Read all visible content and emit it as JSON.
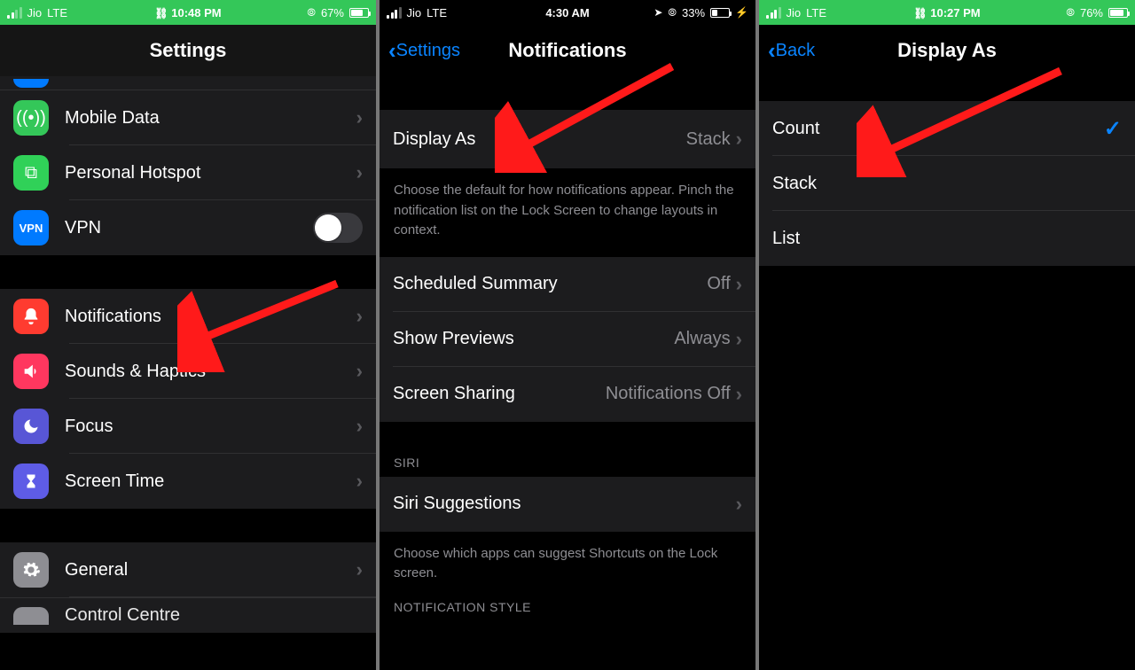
{
  "panel1": {
    "status": {
      "carrier": "Jio",
      "net": "LTE",
      "time": "10:48 PM",
      "battery_pct": "67%",
      "alarm": true,
      "hotspot_link": true
    },
    "title": "Settings",
    "rows": {
      "mobile_data": "Mobile Data",
      "personal_hotspot": "Personal Hotspot",
      "vpn": "VPN",
      "notifications": "Notifications",
      "sounds": "Sounds & Haptics",
      "focus": "Focus",
      "screen_time": "Screen Time",
      "general": "General",
      "control_centre": "Control Centre"
    }
  },
  "panel2": {
    "status": {
      "carrier": "Jio",
      "net": "LTE",
      "time": "4:30 AM",
      "battery_pct": "33%",
      "location": true,
      "alarm": true,
      "charging": true
    },
    "back_label": "Settings",
    "title": "Notifications",
    "rows": {
      "display_as": {
        "label": "Display As",
        "value": "Stack"
      },
      "scheduled": {
        "label": "Scheduled Summary",
        "value": "Off"
      },
      "previews": {
        "label": "Show Previews",
        "value": "Always"
      },
      "sharing": {
        "label": "Screen Sharing",
        "value": "Notifications Off"
      },
      "siri": {
        "label": "Siri Suggestions"
      }
    },
    "note_display": "Choose the default for how notifications appear. Pinch the notification list on the Lock Screen to change layouts in context.",
    "hdr_siri": "SIRI",
    "note_siri": "Choose which apps can suggest Shortcuts on the Lock screen.",
    "hdr_style": "NOTIFICATION STYLE"
  },
  "panel3": {
    "status": {
      "carrier": "Jio",
      "net": "LTE",
      "time": "10:27 PM",
      "battery_pct": "76%",
      "alarm": true,
      "hotspot_link": true
    },
    "back_label": "Back",
    "title": "Display As",
    "options": {
      "count": "Count",
      "stack": "Stack",
      "list": "List"
    },
    "selected": "count"
  }
}
